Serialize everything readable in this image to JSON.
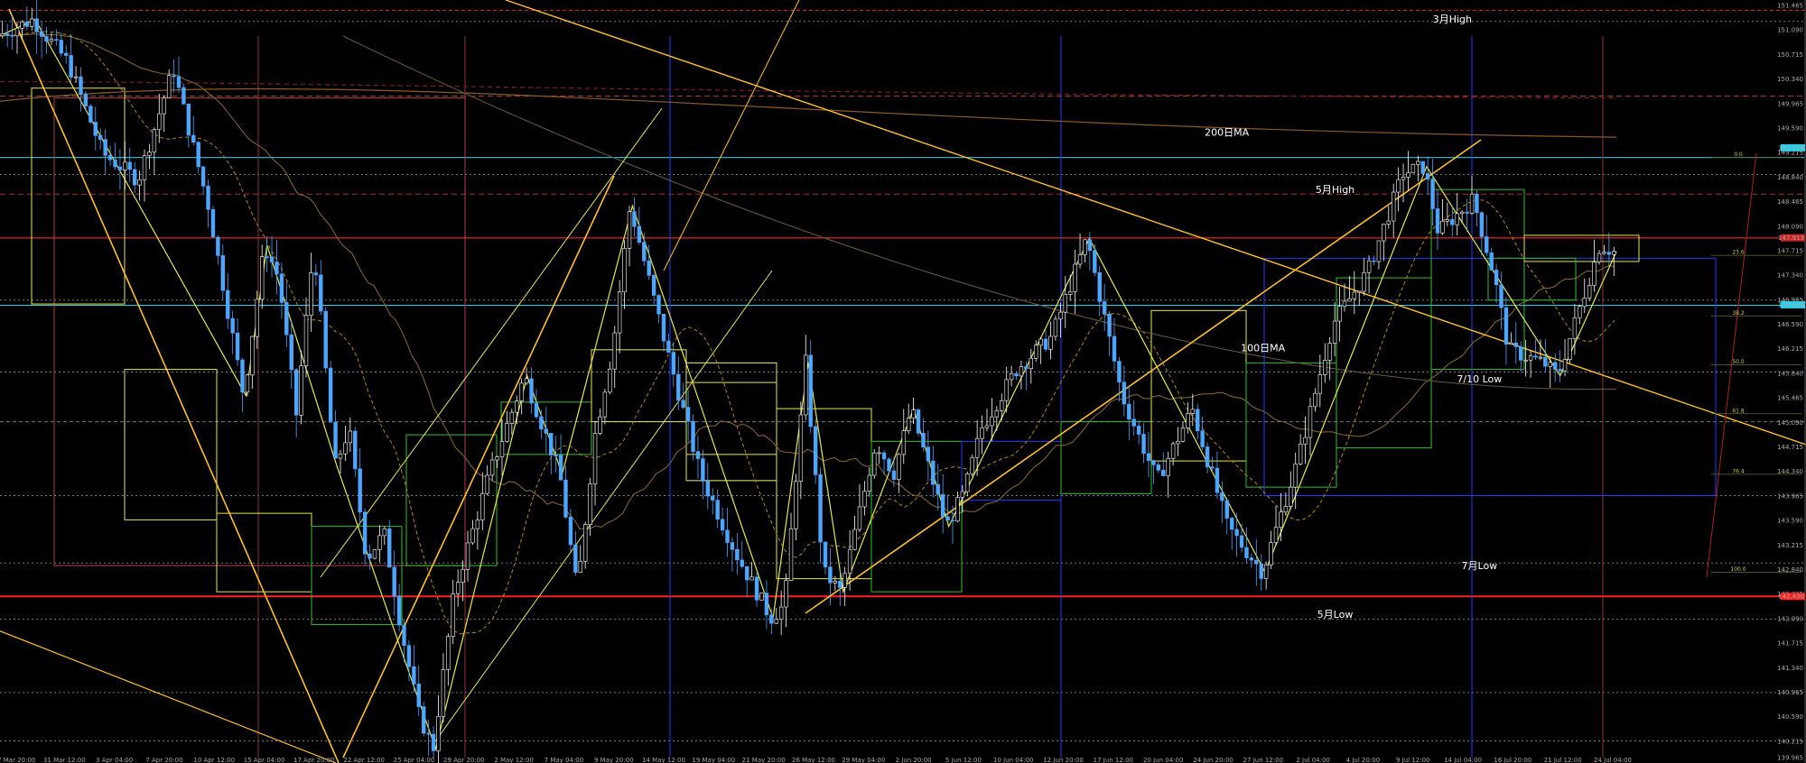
{
  "chart_data": {
    "type": "candlestick",
    "symbol": "USDJPY",
    "grid": false,
    "background": "#000000",
    "colors": {
      "up": "#ffffff",
      "down": "#4da6ff",
      "trendline": "#ffc125",
      "zigzag": "#e8e84a",
      "resistance": "#cc2222",
      "support": "#ff2020",
      "cyan": "#22d3ee",
      "blue": "#1e3cff",
      "green": "#2fbf2f",
      "ma": "#8b6b2e"
    },
    "ylim": [
      139.965,
      151.465
    ],
    "y_ticks": [
      "151.465",
      "151.090",
      "150.715",
      "150.340",
      "149.965",
      "149.590",
      "149.215",
      "148.840",
      "148.465",
      "148.090",
      "147.715",
      "147.340",
      "146.965",
      "146.590",
      "146.215",
      "145.840",
      "145.465",
      "145.090",
      "144.715",
      "144.340",
      "143.965",
      "143.590",
      "143.215",
      "142.840",
      "142.465",
      "142.090",
      "141.715",
      "141.340",
      "140.965",
      "140.590",
      "140.215",
      "139.965"
    ],
    "x_ticks": [
      "27 Mar 20:00",
      "31 Mar 12:00",
      "3 Apr 04:00",
      "7 Apr 20:00",
      "10 Apr 12:00",
      "15 Apr 04:00",
      "17 Apr 20:00",
      "22 Apr 12:00",
      "25 Apr 04:00",
      "29 Apr 20:00",
      "2 May 12:00",
      "7 May 04:00",
      "9 May 20:00",
      "14 May 12:00",
      "19 May 04:00",
      "21 May 20:00",
      "26 May 12:00",
      "29 May 04:00",
      "2 Jun 20:00",
      "5 Jun 12:00",
      "10 Jun 04:00",
      "12 Jun 20:00",
      "17 Jun 12:00",
      "20 Jun 04:00",
      "24 Jun 20:00",
      "27 Jun 12:00",
      "2 Jul 04:00",
      "4 Jul 20:00",
      "9 Jul 12:00",
      "14 Jul 04:00",
      "16 Jul 20:00",
      "21 Jul 12:00",
      "24 Jul 04:00"
    ],
    "price_path": [
      [
        0,
        151.0
      ],
      [
        1,
        151.25
      ],
      [
        2,
        150.6
      ],
      [
        3,
        149.2
      ],
      [
        4,
        148.8
      ],
      [
        5,
        150.5
      ],
      [
        6,
        148.4
      ],
      [
        7,
        145.5
      ],
      [
        7.6,
        147.8
      ],
      [
        8,
        147.3
      ],
      [
        8.5,
        145.2
      ],
      [
        9,
        147.8
      ],
      [
        9.6,
        144.4
      ],
      [
        10,
        145.0
      ],
      [
        10.5,
        143.0
      ],
      [
        11,
        143.4
      ],
      [
        11.5,
        141.9
      ],
      [
        12,
        140.6
      ],
      [
        12.4,
        140.1
      ],
      [
        13,
        142.5
      ],
      [
        14,
        144.3
      ],
      [
        15,
        145.8
      ],
      [
        16,
        144.3
      ],
      [
        16.5,
        142.5
      ],
      [
        17,
        144.9
      ],
      [
        17.5,
        146.2
      ],
      [
        18,
        148.4
      ],
      [
        19,
        146.3
      ],
      [
        20,
        144.3
      ],
      [
        21,
        143.1
      ],
      [
        22,
        142.1
      ],
      [
        22.4,
        142.3
      ],
      [
        23,
        146.0
      ],
      [
        23.5,
        142.8
      ],
      [
        24,
        142.5
      ],
      [
        25,
        144.8
      ],
      [
        25.5,
        144.3
      ],
      [
        26,
        145.3
      ],
      [
        27,
        143.5
      ],
      [
        27.5,
        144.0
      ],
      [
        28,
        145.0
      ],
      [
        29,
        145.9
      ],
      [
        30,
        146.4
      ],
      [
        31,
        147.9
      ],
      [
        32,
        145.5
      ],
      [
        33,
        144.2
      ],
      [
        34,
        145.3
      ],
      [
        35,
        143.5
      ],
      [
        36,
        142.8
      ],
      [
        37,
        144.5
      ],
      [
        38,
        146.6
      ],
      [
        39,
        147.4
      ],
      [
        40,
        148.9
      ],
      [
        40.6,
        149.0
      ],
      [
        41,
        148.0
      ],
      [
        42,
        148.5
      ],
      [
        42.6,
        147.3
      ],
      [
        43,
        146.2
      ],
      [
        44,
        146.0
      ],
      [
        44.4,
        145.8
      ],
      [
        45,
        146.8
      ],
      [
        45.6,
        147.8
      ],
      [
        46,
        147.7
      ]
    ],
    "annotations": [
      {
        "label": "3月High",
        "price": 151.2,
        "x_fraction": 0.805
      },
      {
        "label": "200日MA",
        "price": 149.47,
        "x_fraction": 0.68
      },
      {
        "label": "5月High",
        "price": 148.6,
        "x_fraction": 0.74
      },
      {
        "label": "100日MA",
        "price": 146.18,
        "x_fraction": 0.7
      },
      {
        "label": "7/10 Low",
        "price": 145.7,
        "x_fraction": 0.82
      },
      {
        "label": "7月Low",
        "price": 142.85,
        "x_fraction": 0.82
      },
      {
        "label": "5月Low",
        "price": 142.1,
        "x_fraction": 0.74
      }
    ],
    "fib_levels": [
      "0.0",
      "23.6",
      "38.2",
      "50.0",
      "61.8",
      "76.4",
      "100.0"
    ],
    "price_badges": [
      "147.913",
      "146.888",
      "149.288",
      "142.430"
    ]
  }
}
